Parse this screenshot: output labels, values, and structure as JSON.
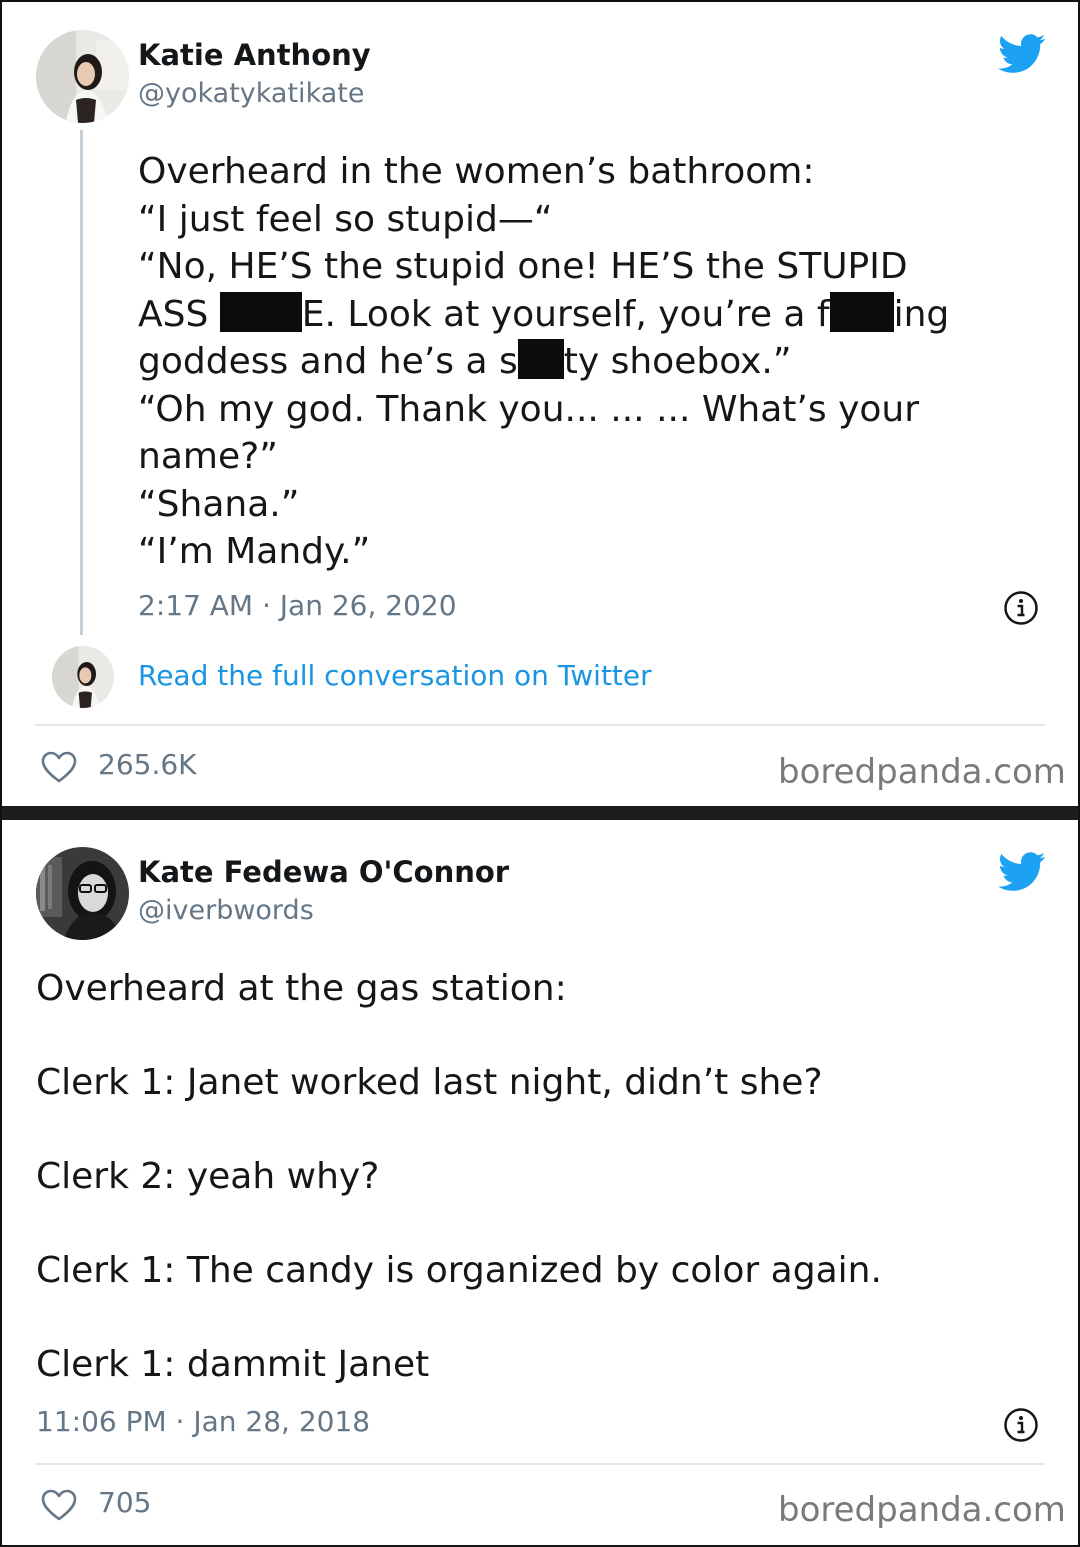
{
  "colors": {
    "twitter_blue": "#1da1f2",
    "link_blue": "#1b95e0",
    "text_primary": "#14171a",
    "text_secondary": "#657786",
    "separator": "#e1e8ed"
  },
  "tweets": [
    {
      "author": {
        "display_name": "Katie Anthony",
        "handle": "@yokatykatikate",
        "avatar_icon": "profile-photo"
      },
      "logo_icon": "twitter-bird-icon",
      "text_lines": {
        "l1": "Overheard in the women’s bathroom:",
        "l2": "“I just feel so stupid—“",
        "l3": "“No, HE’S the stupid one! HE’S the STUPID",
        "l4a": "ASS ",
        "l4b": "E. Look at yourself, you’re a f",
        "l4c": "ing",
        "l5a": "goddess and he’s a s",
        "l5b": "ty shoebox.”",
        "l6": "“Oh my god. Thank you... ... ... What’s your",
        "l7": "name?”",
        "l8": "“Shana.”",
        "l9": "“I’m Mandy.”"
      },
      "timestamp": "2:17 AM · Jan 26, 2020",
      "info_icon": "info-icon",
      "read_more": "Read the full conversation on Twitter",
      "likes": "265.6K",
      "watermark": "boredpanda.com"
    },
    {
      "author": {
        "display_name": "Kate Fedewa O'Connor",
        "handle": "@iverbwords",
        "avatar_icon": "profile-photo"
      },
      "logo_icon": "twitter-bird-icon",
      "text_lines": {
        "l1": "Overheard at the gas station:",
        "l2": "Clerk 1: Janet worked last night, didn’t she?",
        "l3": "Clerk 2: yeah why?",
        "l4": "Clerk 1: The candy is organized by color again.",
        "l5": "Clerk 1: dammit Janet"
      },
      "timestamp": "11:06 PM · Jan 28, 2018",
      "info_icon": "info-icon",
      "likes": "705",
      "watermark": "boredpanda.com"
    }
  ]
}
